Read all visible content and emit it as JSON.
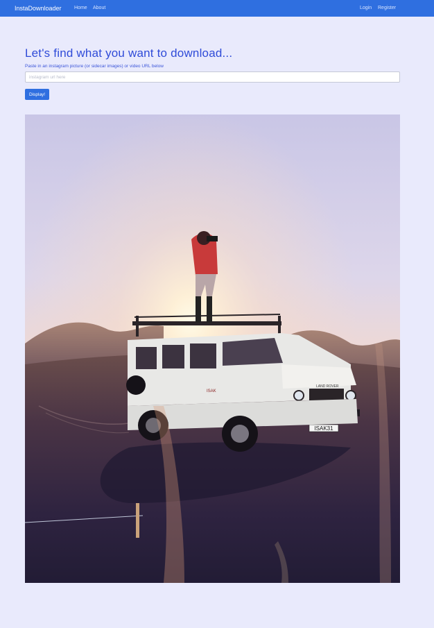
{
  "nav": {
    "brand": "InstaDownloader",
    "home": "Home",
    "about": "About",
    "login": "Login",
    "register": "Register"
  },
  "main": {
    "heading": "Let's find what you want to download...",
    "help_text": "Paste in an instagram picture (or sidecar images) or video URL below",
    "url_placeholder": "instagram url here",
    "display_button": "Display!"
  },
  "preview": {
    "plate_text": "ISAK31",
    "door_text": "ISAK",
    "hood_text": "LAND ROVER"
  },
  "colors": {
    "navbar": "#2f6fe0",
    "page_bg": "#e9eafc",
    "heading": "#2f4bd8"
  }
}
